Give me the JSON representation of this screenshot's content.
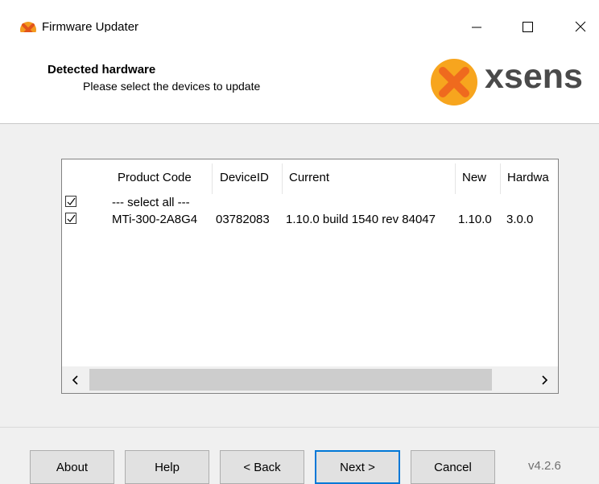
{
  "window": {
    "title": "Firmware Updater",
    "icon": "xsens-x-icon"
  },
  "header": {
    "title": "Detected hardware",
    "subtitle": "Please select the devices to update",
    "logo_text": "xsens"
  },
  "device_list": {
    "columns": [
      "Product Code",
      "DeviceID",
      "Current",
      "New",
      "Hardwa"
    ],
    "select_all": {
      "checked": true,
      "label": "--- select all ---"
    },
    "rows": [
      {
        "checked": true,
        "product_code": "MTi-300-2A8G4",
        "device_id": "03782083",
        "current": "1.10.0 build 1540 rev 84047",
        "new": "1.10.0",
        "hardware": "3.0.0"
      }
    ]
  },
  "buttons": {
    "about": "About",
    "help": "Help",
    "back": "< Back",
    "next": "Next >",
    "cancel": "Cancel"
  },
  "version": "v4.2.6",
  "colors": {
    "accent": "#0078d7",
    "logo_orange": "#f7941d",
    "logo_text": "#4a4a4a"
  }
}
